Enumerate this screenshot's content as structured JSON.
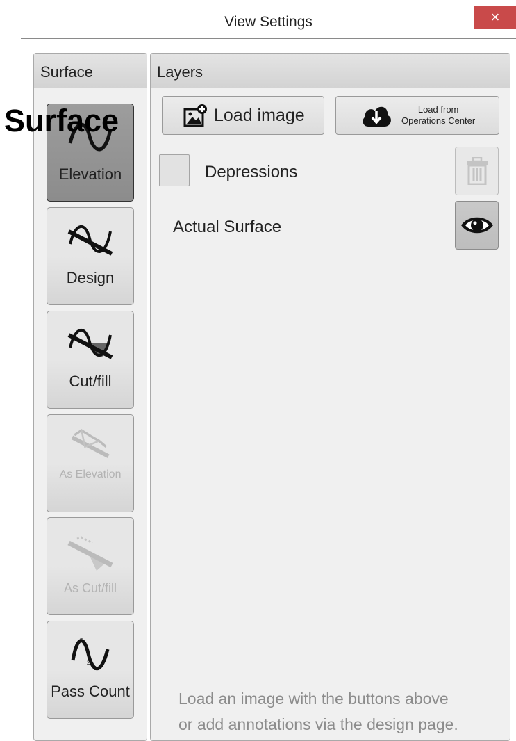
{
  "window": {
    "title": "View Settings",
    "close_glyph": "×"
  },
  "overlay": {
    "label": "Surface"
  },
  "surface_panel": {
    "header": "Surface",
    "items": [
      {
        "label": "Elevation",
        "icon": "elevation-wave-icon",
        "state": "selected"
      },
      {
        "label": "Design",
        "icon": "design-wave-icon",
        "state": "enabled"
      },
      {
        "label": "Cut/fill",
        "icon": "cut-fill-wave-icon",
        "state": "enabled"
      },
      {
        "label": "As Elevation",
        "icon": "as-elevation-icon",
        "state": "disabled"
      },
      {
        "label": "As Cut/fill",
        "icon": "as-cut-fill-icon",
        "state": "disabled"
      },
      {
        "label": "Pass Count",
        "icon": "pass-count-wave-icon",
        "state": "enabled"
      }
    ]
  },
  "layers_panel": {
    "header": "Layers",
    "load_image_label": "Load image",
    "load_oc_line1": "Load from",
    "load_oc_line2": "Operations Center",
    "layers": [
      {
        "label": "Depressions",
        "checked": false
      },
      {
        "label": "Actual Surface"
      }
    ],
    "hint_line1": "Load an image with the buttons above",
    "hint_line2": "or add annotations via the design page."
  },
  "colors": {
    "close_button": "#c94a4a",
    "panel_bg": "#f0f0f0",
    "disabled_text": "#b3b3b3",
    "hint_text": "#8c8c8c"
  }
}
